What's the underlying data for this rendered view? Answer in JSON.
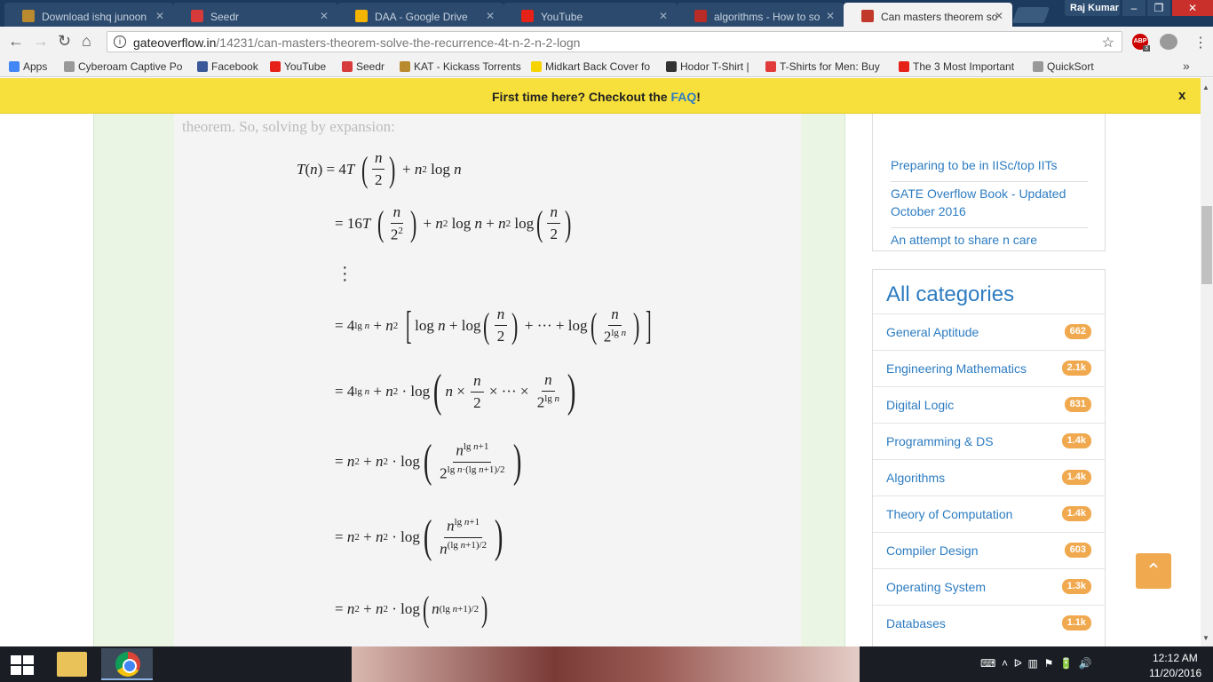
{
  "browser": {
    "tabs": [
      {
        "title": "Download ishq junoon",
        "icon": "shield-icon",
        "color": "#b98a2e"
      },
      {
        "title": "Seedr",
        "icon": "seedr-icon",
        "color": "#d63a3a"
      },
      {
        "title": "DAA - Google Drive",
        "icon": "drive-icon",
        "color": "#f4b400"
      },
      {
        "title": "YouTube",
        "icon": "youtube-icon",
        "color": "#e62117"
      },
      {
        "title": "algorithms - How to so",
        "icon": "quora-icon",
        "color": "#b92b27"
      },
      {
        "title": "Can masters theorem so",
        "icon": "gateoverflow-icon",
        "color": "#c0392b",
        "active": true
      }
    ],
    "profile": "Raj Kumar",
    "url_host": "gateoverflow.in",
    "url_path": "/14231/can-masters-theorem-solve-the-recurrence-4t-n-2-n-2-logn",
    "ext_badge": "ABP",
    "ext_count": "3",
    "bookmarks": [
      {
        "label": "Apps",
        "icon": "apps-grid-icon",
        "color": "#4285f4"
      },
      {
        "label": "Cyberoam Captive Po",
        "icon": "page-icon",
        "color": "#999999"
      },
      {
        "label": "Facebook",
        "icon": "facebook-icon",
        "color": "#3b5998"
      },
      {
        "label": "YouTube",
        "icon": "youtube-icon",
        "color": "#e62117"
      },
      {
        "label": "Seedr",
        "icon": "seedr-icon",
        "color": "#d63a3a"
      },
      {
        "label": "KAT - Kickass Torrents",
        "icon": "shield-icon",
        "color": "#b98a2e"
      },
      {
        "label": "Midkart Back Cover fo",
        "icon": "flipkart-icon",
        "color": "#f7d400"
      },
      {
        "label": "Hodor T-Shirt |",
        "icon": "tshirt-icon",
        "color": "#333333"
      },
      {
        "label": "T-Shirts for Men: Buy",
        "icon": "tshirt-icon",
        "color": "#e23b3b"
      },
      {
        "label": "The 3 Most Important",
        "icon": "youtube-icon",
        "color": "#e62117"
      },
      {
        "label": "QuickSort",
        "icon": "page-icon",
        "color": "#999999"
      }
    ]
  },
  "banner": {
    "text": "First time here? Checkout the ",
    "link": "FAQ",
    "suffix": "!",
    "close": "x"
  },
  "content": {
    "cut_text": "theorem. So, solving by expansion:",
    "equations": [
      {
        "lhs": "T(n)",
        "text": "= 4T (n/2) + n² log n"
      },
      {
        "text": "= 16T (n/2²) + n² log n + n² log(n/2)"
      },
      {
        "text": "⋮"
      },
      {
        "text": "= 4^(lg n) + n² [log n + log(n/2) + ⋯ + log(n/2^(lg n))]"
      },
      {
        "text": "= 4^(lg n) + n² · log(n × n/2 × ⋯ × n/2^(lg n))"
      },
      {
        "text": "= n² + n² · log(n^(lg n+1) / 2^(lg n·(lg n+1)/2))"
      },
      {
        "text": "= n² + n² · log(n^(lg n+1) / n^((lg n+1)/2))"
      },
      {
        "text": "= n² + n² · log(n^((lg n+1)/2))"
      }
    ]
  },
  "sidebar": {
    "recent_links": [
      "Preparing to be in IISc/top IITs",
      "GATE Overflow Book - Updated October 2016",
      "An attempt to share n care"
    ],
    "categories_title": "All categories",
    "categories": [
      {
        "name": "General Aptitude",
        "count": "662"
      },
      {
        "name": "Engineering Mathematics",
        "count": "2.1k"
      },
      {
        "name": "Digital Logic",
        "count": "831"
      },
      {
        "name": "Programming & DS",
        "count": "1.4k"
      },
      {
        "name": "Algorithms",
        "count": "1.4k"
      },
      {
        "name": "Theory of Computation",
        "count": "1.4k"
      },
      {
        "name": "Compiler Design",
        "count": "603"
      },
      {
        "name": "Operating System",
        "count": "1.3k"
      },
      {
        "name": "Databases",
        "count": "1.1k"
      }
    ]
  },
  "taskbar": {
    "time": "12:12 AM",
    "date": "11/20/2016"
  }
}
